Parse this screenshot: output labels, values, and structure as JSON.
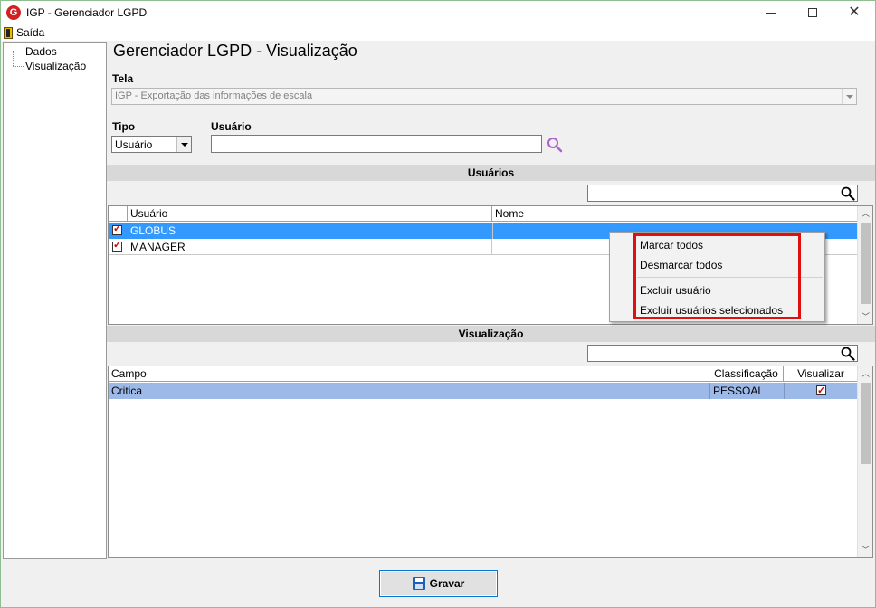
{
  "window": {
    "title": "IGP - Gerenciador LGPD",
    "app_icon": "G"
  },
  "menu": {
    "exit_label": "Saída"
  },
  "tree": {
    "items": [
      {
        "label": "Dados"
      },
      {
        "label": "Visualização"
      }
    ]
  },
  "page": {
    "title": "Gerenciador LGPD - Visualização"
  },
  "form": {
    "tela_label": "Tela",
    "tela_value": "IGP - Exportação das informações de escala",
    "tipo_label": "Tipo",
    "tipo_value": "Usuário",
    "usuario_label": "Usuário",
    "usuario_value": ""
  },
  "users_section": {
    "header": "Usuários",
    "filter_value": "",
    "columns": [
      "Usuário",
      "Nome"
    ],
    "rows": [
      {
        "checked": true,
        "usuario": "GLOBUS",
        "nome": "",
        "selected": true
      },
      {
        "checked": true,
        "usuario": "MANAGER",
        "nome": "",
        "selected": false
      }
    ]
  },
  "context_menu": {
    "items": [
      "Marcar todos",
      "Desmarcar todos",
      "Excluir usuário",
      "Excluir usuários selecionados"
    ]
  },
  "view_section": {
    "header": "Visualização",
    "filter_value": "",
    "columns": [
      "Campo",
      "Classificação",
      "Visualizar"
    ],
    "rows": [
      {
        "campo": "Critica",
        "classificacao": "PESSOAL",
        "visualizar": true
      }
    ]
  },
  "footer": {
    "save_label": "Gravar"
  },
  "colors": {
    "selection": "#3399ff",
    "row_highlight": "#9db9e8",
    "accent_red": "#e01010"
  }
}
